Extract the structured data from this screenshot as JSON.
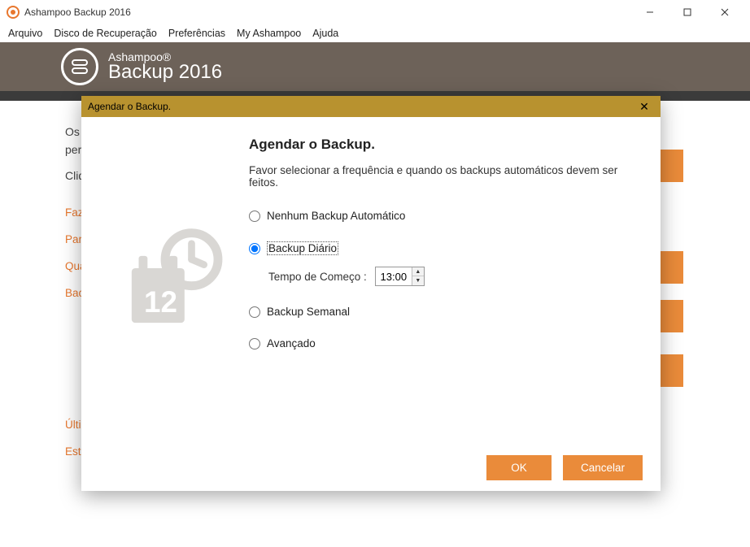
{
  "window": {
    "title": "Ashampoo Backup 2016",
    "menu": [
      "Arquivo",
      "Disco de Recuperação",
      "Preferências",
      "My Ashampoo",
      "Ajuda"
    ]
  },
  "banner": {
    "brand_line1": "Ashampoo®",
    "brand_line2": "Backup 2016"
  },
  "background": {
    "line1": "Os b",
    "line2": "pert",
    "line3": "Cliqu",
    "links": [
      "Faze",
      "Para",
      "Qua",
      "Back"
    ],
    "bottom_links": [
      "Últi",
      "Esta"
    ]
  },
  "modal": {
    "titlebar": "Agendar o Backup.",
    "heading": "Agendar o Backup.",
    "subtext": "Favor selecionar a frequência e quando os backups automáticos devem ser feitos.",
    "options": {
      "none": "Nenhum Backup Automático",
      "daily": "Backup Diário",
      "weekly": "Backup Semanal",
      "advanced": "Avançado"
    },
    "start_time_label": "Tempo de Começo :",
    "start_time_value": "13:00",
    "ok": "OK",
    "cancel": "Cancelar"
  }
}
